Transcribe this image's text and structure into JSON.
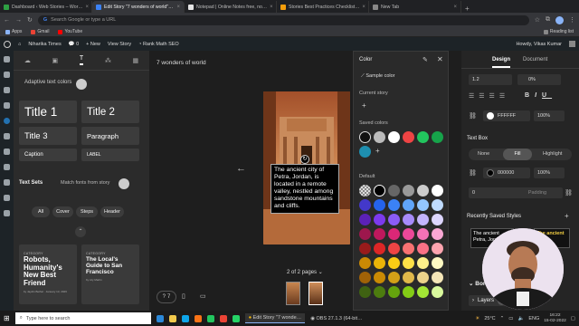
{
  "browser": {
    "tabs": [
      {
        "label": "Dashboard ‹ Web Stories – Wor…",
        "color": "#2ea043",
        "active": false
      },
      {
        "label": "Edit Story \"7 wonders of world\"…",
        "color": "#3b82f6",
        "active": true
      },
      {
        "label": "Notepad | Online Notes free, no…",
        "color": "#e5e5e5",
        "active": false
      },
      {
        "label": "Stories Best Practices Checklist…",
        "color": "#f59e0b",
        "active": false
      },
      {
        "label": "New Tab",
        "color": "#888888",
        "active": false
      }
    ],
    "new_tab_label": "+",
    "omnibox_placeholder": "Search Google or type a URL",
    "bookmarks": [
      {
        "label": "Apps",
        "color": "#8ab4f8"
      },
      {
        "label": "Gmail",
        "color": "#ea4335"
      },
      {
        "label": "YouTube",
        "color": "#ff0000"
      }
    ],
    "reading_list": "Reading list"
  },
  "wp_admin_bar": {
    "site_name": "Niharika Times",
    "comments": "0",
    "new_label": "+ New",
    "view_story": "View Story",
    "rank_math": "Rank Math SEO",
    "greeting": "Howdy, Vikas Kumar"
  },
  "left_panel": {
    "adaptive_label": "Adaptive text colors",
    "presets": {
      "title1": "Title 1",
      "title2": "Title 2",
      "title3": "Title 3",
      "paragraph": "Paragraph",
      "caption": "Caption",
      "label": "LABEL"
    },
    "text_sets_label": "Text Sets",
    "match_fonts_label": "Match fonts from story",
    "filters": [
      "All",
      "Cover",
      "Steps",
      "Header"
    ],
    "cards": [
      {
        "category": "CATEGORY",
        "title": "Robots, Humanity's New Best Friend",
        "byline": "by Jaydin Bethel · January 13, 2026"
      },
      {
        "category": "CATEGORY",
        "title": "The Local's Guide to San Francisco",
        "byline": "by Lily Martin"
      }
    ]
  },
  "canvas": {
    "story_title": "7 wonders of world",
    "text_content": "The ancient city of Petra, Jordan, is located in a remote valley, nestled among sandstone mountains and cliffs.",
    "pages_label": "2 of 2 pages",
    "help_count": "7"
  },
  "color_popup": {
    "title": "Color",
    "sample_color": "Sample color",
    "current_story": "Current story",
    "saved_colors": "Saved colors",
    "default": "Default",
    "saved": [
      "#111111",
      "#bbbbbb",
      "#ffffff",
      "#ef4444",
      "#22c55e",
      "#16a34a",
      "#1e8fb0"
    ],
    "palette": [
      [
        "#transparent",
        "#000000",
        "#666666",
        "#999999",
        "#cccccc",
        "#ffffff"
      ],
      [
        "#4338ca",
        "#2563eb",
        "#3b82f6",
        "#60a5fa",
        "#93c5fd",
        "#bfdbfe"
      ],
      [
        "#5b21b6",
        "#7c3aed",
        "#8b5cf6",
        "#a78bfa",
        "#c4b5fd",
        "#ddd6fe"
      ],
      [
        "#9d174d",
        "#be185d",
        "#db2777",
        "#ec4899",
        "#f472b6",
        "#f9a8d4"
      ],
      [
        "#991b1b",
        "#dc2626",
        "#ef4444",
        "#f87171",
        "#fb7185",
        "#fda4af"
      ],
      [
        "#ca8a04",
        "#eab308",
        "#facc15",
        "#fde047",
        "#fef08a",
        "#fef9c3"
      ],
      [
        "#a16207",
        "#ca8a04",
        "#d4a017",
        "#e0b84a",
        "#ecd38a",
        "#f5e6b8"
      ],
      [
        "#3f6212",
        "#4d7c0f",
        "#65a30d",
        "#84cc16",
        "#a3e635",
        "#d9f99d"
      ]
    ]
  },
  "right_panel": {
    "tabs": [
      "Design",
      "Document"
    ],
    "line_height": "1.2",
    "letter_spacing": "0%",
    "color_hex": "FFFFFF",
    "color_opacity": "100%",
    "text_box_label": "Text Box",
    "fill_options": [
      "None",
      "Fill",
      "Highlight"
    ],
    "bg_hex": "000000",
    "bg_opacity": "100%",
    "padding_value": "0",
    "padding_label": "Padding",
    "recent_styles_label": "Recently Saved Styles",
    "recent_style_sample": "The ancient Petra, Jordan,",
    "border_label": "Bord",
    "layers_label": "Layers",
    "layers_count": "2"
  },
  "taskbar": {
    "search_placeholder": "Type here to search",
    "apps": [
      {
        "label": "",
        "color": "#2b88d8"
      },
      {
        "label": "",
        "color": "#f2c94c"
      },
      {
        "label": "",
        "color": "#0ea5e9"
      },
      {
        "label": "",
        "color": "#f97316"
      },
      {
        "label": "",
        "color": "#22c55e"
      },
      {
        "label": "",
        "color": "#ea4335"
      },
      {
        "label": "",
        "color": "#25d366"
      }
    ],
    "active_app": "Edit Story \"7 wonde…",
    "obs_app": "OBS 27.1.3 (64-bit…",
    "temperature": "25°C",
    "language": "ENG",
    "time": "16:22",
    "date": "15-02-2022"
  }
}
